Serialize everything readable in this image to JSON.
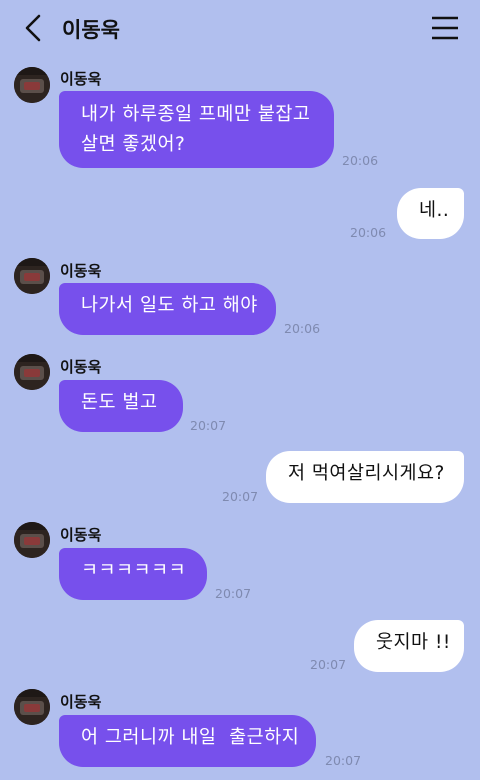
{
  "header": {
    "title": "이동욱"
  },
  "messages": [
    {
      "sender": "이동욱",
      "lines": [
        "내가 하루종일 프메만 붙잡고",
        "살면 좋겠어?"
      ],
      "time": "20:06"
    },
    {
      "lines": [
        "네.."
      ],
      "time": "20:06"
    },
    {
      "sender": "이동욱",
      "lines": [
        "나가서 일도 하고 해야"
      ],
      "time": "20:06"
    },
    {
      "sender": "이동욱",
      "lines": [
        "돈도 벌고"
      ],
      "time": "20:07"
    },
    {
      "lines": [
        "저 먹여살리시게요?"
      ],
      "time": "20:07"
    },
    {
      "sender": "이동욱",
      "lines": [
        "ㅋㅋㅋㅋㅋㅋ"
      ],
      "time": "20:07"
    },
    {
      "lines": [
        "웃지마 !!"
      ],
      "time": "20:07"
    },
    {
      "sender": "이동욱",
      "lines": [
        "어 그러니까 내일  출근하지"
      ],
      "time": "20:07"
    }
  ]
}
